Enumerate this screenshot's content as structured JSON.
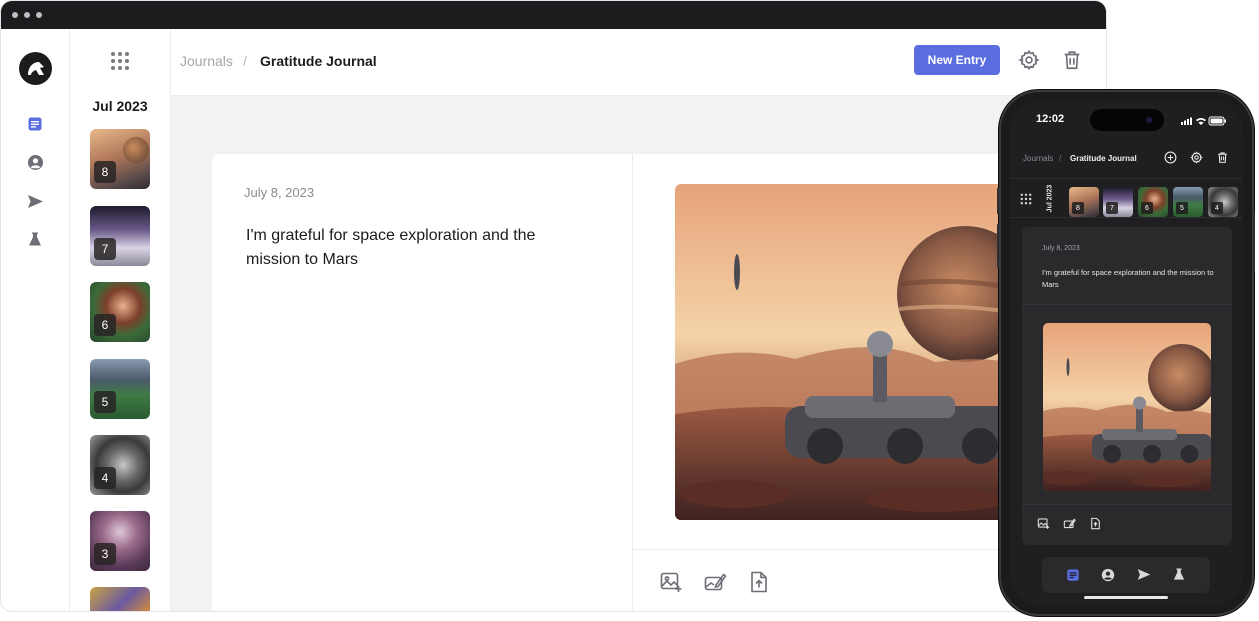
{
  "window": {
    "controls": [
      "close",
      "minimize",
      "maximize"
    ]
  },
  "sidebar": {
    "logo_icon": "app-logo-icon",
    "items": [
      {
        "icon": "journal-icon",
        "active": true
      },
      {
        "icon": "profile-icon",
        "active": false
      },
      {
        "icon": "send-icon",
        "active": false
      },
      {
        "icon": "flask-icon",
        "active": false
      }
    ],
    "accent": "#5b6ee0"
  },
  "thumbnails": {
    "menu_icon": "grid-dots-icon",
    "month": "Jul 2023",
    "items": [
      {
        "day": "8"
      },
      {
        "day": "7"
      },
      {
        "day": "6"
      },
      {
        "day": "5"
      },
      {
        "day": "4"
      },
      {
        "day": "3"
      },
      {
        "day": ""
      }
    ]
  },
  "header": {
    "breadcrumb_root": "Journals",
    "breadcrumb_sep": "/",
    "breadcrumb_current": "Gratitude Journal",
    "new_entry_label": "New Entry",
    "settings_icon": "gear-icon",
    "delete_icon": "trash-icon"
  },
  "entry": {
    "date": "July 8, 2023",
    "text": "I'm grateful for space exploration and the mission to Mars",
    "image_alt": "Rover on Mars with a planet in the sky",
    "tools": [
      "add-image-icon",
      "edit-image-icon",
      "upload-icon"
    ]
  },
  "phone": {
    "time": "12:02",
    "breadcrumb_root": "Journals",
    "breadcrumb_sep": "/",
    "breadcrumb_current": "Gratitude Journal",
    "month": "Jul 2023",
    "thumbs": [
      "8",
      "7",
      "6",
      "5",
      "4"
    ],
    "entry_date": "July 8, 2023",
    "entry_text": "I'm grateful for space exploration and the mission to Mars"
  }
}
